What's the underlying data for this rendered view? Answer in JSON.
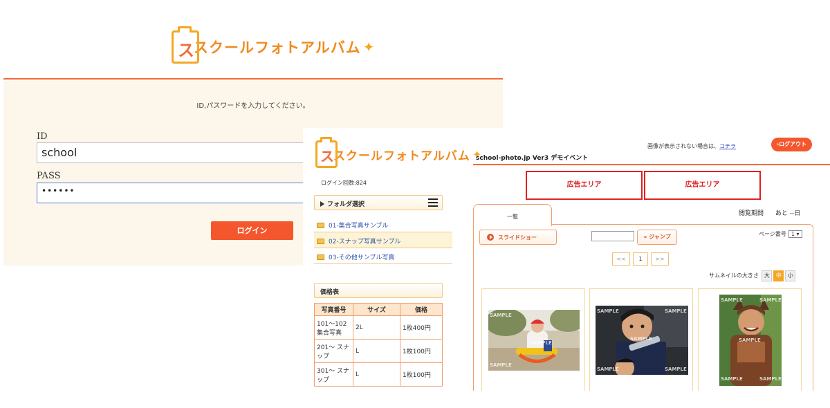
{
  "login": {
    "logo_text": "スクールフォトアルバム",
    "logo_s": "ス",
    "logo_sparkle": "✦",
    "instruction": "ID,パスワードを入力してください。",
    "id_label": "ID",
    "id_value": "school",
    "pass_label": "PASS",
    "pass_value": "••••••",
    "login_button": "ログイン"
  },
  "album": {
    "logo_text": "スクールフォトアルバム",
    "logo_s": "ス",
    "logo_sparkle": "✦",
    "login_count": "ログイン回数:824",
    "notice_text": "画像が表示されない場合は、",
    "notice_link": "コチラ",
    "logout_button": "›ログアウト",
    "event_title": "school-photo.jp Ver3 デモイベント",
    "ads": [
      "広告エリア",
      "広告エリア"
    ],
    "folder_header": "フォルダ選択",
    "folders": [
      "01-集合写真サンプル",
      "02-スナップ写真サンプル",
      "03-その他サンプル写真"
    ],
    "price_header": "価格表",
    "price_table": {
      "columns": [
        "写真番号",
        "サイズ",
        "価格"
      ],
      "rows": [
        [
          "101～102 集合写真",
          "2L",
          "1枚400円"
        ],
        [
          "201～ スナップ",
          "L",
          "1枚100円"
        ],
        [
          "301～ スナップ",
          "L",
          "1枚100円"
        ]
      ]
    },
    "tab_label": "一覧",
    "period_label": "閲覧期間",
    "period_value": "あと --日",
    "slideshow_button": "スライドショー",
    "jump_button": "» ジャンプ",
    "page_number_label": "ページ番号",
    "page_number_value": "1 ▾",
    "pager": {
      "prev": "<<",
      "current": "1",
      "next": ">>"
    },
    "thumb_size_label": "サムネイルの大きさ",
    "thumb_sizes": [
      "大",
      "中",
      "小"
    ],
    "watermark": "SAMPLE"
  },
  "colors": {
    "accent_orange": "#f26b3a",
    "logo_orange": "#f08a1e",
    "ad_red": "#e02020",
    "login_bg": "#fdf6ea"
  }
}
